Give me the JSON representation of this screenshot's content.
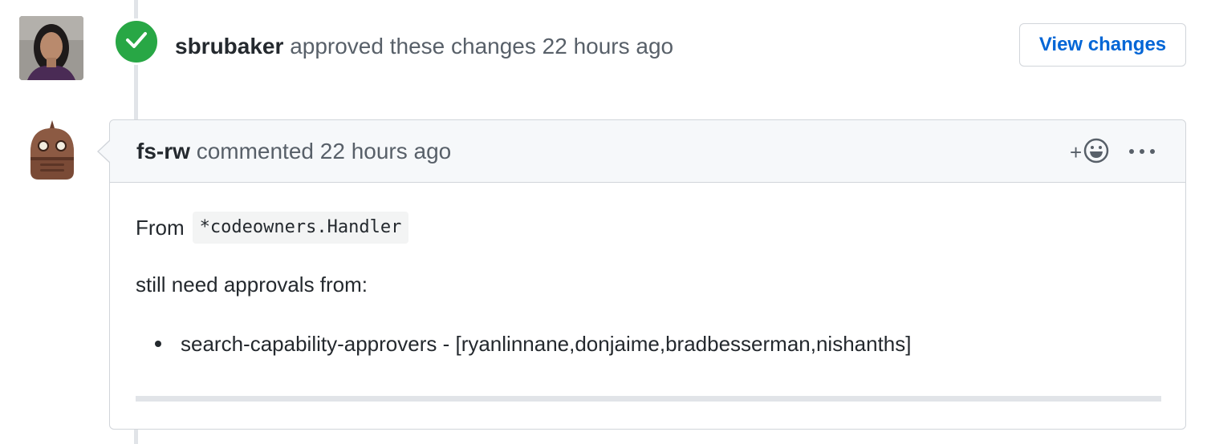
{
  "approval": {
    "author": "sbrubaker",
    "action": "approved these changes",
    "time": "22 hours ago",
    "view_changes_label": "View changes"
  },
  "comment": {
    "author": "fs-rw",
    "action": "commented",
    "time": "22 hours ago",
    "reaction_plus": "+",
    "body": {
      "from_label": "From",
      "code": "*codeowners.Handler",
      "still_need": "still need approvals from:",
      "list_items": [
        "search-capability-approvers - [ryanlinnane,donjaime,bradbesserman,nishanths]"
      ]
    }
  },
  "icons": {
    "approval_status": "check-icon",
    "reaction": "smiley-icon",
    "more": "kebab-horizontal-icon"
  },
  "colors": {
    "approved_green": "#28a745",
    "link_blue": "#0366d6",
    "border": "#d1d5da",
    "header_bg": "#f6f8fa"
  }
}
